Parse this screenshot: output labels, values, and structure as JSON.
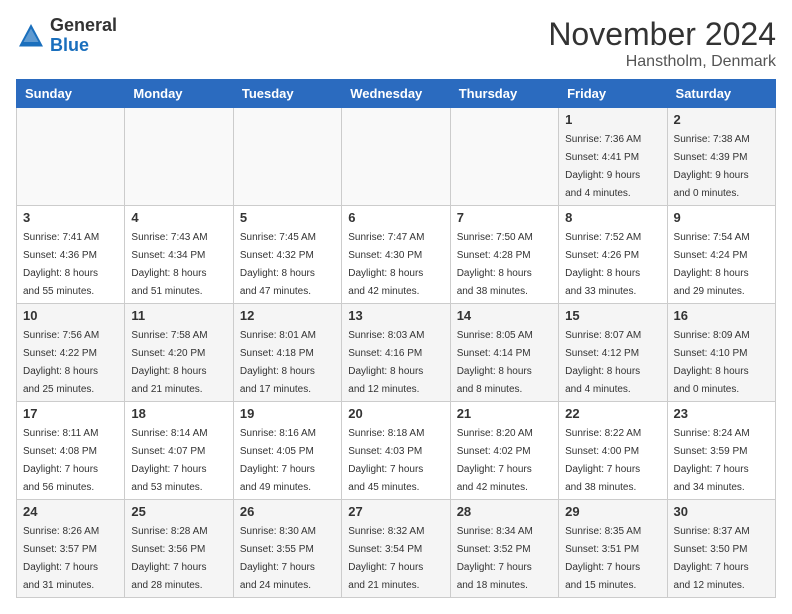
{
  "logo": {
    "general": "General",
    "blue": "Blue"
  },
  "title": "November 2024",
  "location": "Hanstholm, Denmark",
  "days_of_week": [
    "Sunday",
    "Monday",
    "Tuesday",
    "Wednesday",
    "Thursday",
    "Friday",
    "Saturday"
  ],
  "weeks": [
    [
      {
        "day": "",
        "info": ""
      },
      {
        "day": "",
        "info": ""
      },
      {
        "day": "",
        "info": ""
      },
      {
        "day": "",
        "info": ""
      },
      {
        "day": "",
        "info": ""
      },
      {
        "day": "1",
        "info": "Sunrise: 7:36 AM\nSunset: 4:41 PM\nDaylight: 9 hours\nand 4 minutes."
      },
      {
        "day": "2",
        "info": "Sunrise: 7:38 AM\nSunset: 4:39 PM\nDaylight: 9 hours\nand 0 minutes."
      }
    ],
    [
      {
        "day": "3",
        "info": "Sunrise: 7:41 AM\nSunset: 4:36 PM\nDaylight: 8 hours\nand 55 minutes."
      },
      {
        "day": "4",
        "info": "Sunrise: 7:43 AM\nSunset: 4:34 PM\nDaylight: 8 hours\nand 51 minutes."
      },
      {
        "day": "5",
        "info": "Sunrise: 7:45 AM\nSunset: 4:32 PM\nDaylight: 8 hours\nand 47 minutes."
      },
      {
        "day": "6",
        "info": "Sunrise: 7:47 AM\nSunset: 4:30 PM\nDaylight: 8 hours\nand 42 minutes."
      },
      {
        "day": "7",
        "info": "Sunrise: 7:50 AM\nSunset: 4:28 PM\nDaylight: 8 hours\nand 38 minutes."
      },
      {
        "day": "8",
        "info": "Sunrise: 7:52 AM\nSunset: 4:26 PM\nDaylight: 8 hours\nand 33 minutes."
      },
      {
        "day": "9",
        "info": "Sunrise: 7:54 AM\nSunset: 4:24 PM\nDaylight: 8 hours\nand 29 minutes."
      }
    ],
    [
      {
        "day": "10",
        "info": "Sunrise: 7:56 AM\nSunset: 4:22 PM\nDaylight: 8 hours\nand 25 minutes."
      },
      {
        "day": "11",
        "info": "Sunrise: 7:58 AM\nSunset: 4:20 PM\nDaylight: 8 hours\nand 21 minutes."
      },
      {
        "day": "12",
        "info": "Sunrise: 8:01 AM\nSunset: 4:18 PM\nDaylight: 8 hours\nand 17 minutes."
      },
      {
        "day": "13",
        "info": "Sunrise: 8:03 AM\nSunset: 4:16 PM\nDaylight: 8 hours\nand 12 minutes."
      },
      {
        "day": "14",
        "info": "Sunrise: 8:05 AM\nSunset: 4:14 PM\nDaylight: 8 hours\nand 8 minutes."
      },
      {
        "day": "15",
        "info": "Sunrise: 8:07 AM\nSunset: 4:12 PM\nDaylight: 8 hours\nand 4 minutes."
      },
      {
        "day": "16",
        "info": "Sunrise: 8:09 AM\nSunset: 4:10 PM\nDaylight: 8 hours\nand 0 minutes."
      }
    ],
    [
      {
        "day": "17",
        "info": "Sunrise: 8:11 AM\nSunset: 4:08 PM\nDaylight: 7 hours\nand 56 minutes."
      },
      {
        "day": "18",
        "info": "Sunrise: 8:14 AM\nSunset: 4:07 PM\nDaylight: 7 hours\nand 53 minutes."
      },
      {
        "day": "19",
        "info": "Sunrise: 8:16 AM\nSunset: 4:05 PM\nDaylight: 7 hours\nand 49 minutes."
      },
      {
        "day": "20",
        "info": "Sunrise: 8:18 AM\nSunset: 4:03 PM\nDaylight: 7 hours\nand 45 minutes."
      },
      {
        "day": "21",
        "info": "Sunrise: 8:20 AM\nSunset: 4:02 PM\nDaylight: 7 hours\nand 42 minutes."
      },
      {
        "day": "22",
        "info": "Sunrise: 8:22 AM\nSunset: 4:00 PM\nDaylight: 7 hours\nand 38 minutes."
      },
      {
        "day": "23",
        "info": "Sunrise: 8:24 AM\nSunset: 3:59 PM\nDaylight: 7 hours\nand 34 minutes."
      }
    ],
    [
      {
        "day": "24",
        "info": "Sunrise: 8:26 AM\nSunset: 3:57 PM\nDaylight: 7 hours\nand 31 minutes."
      },
      {
        "day": "25",
        "info": "Sunrise: 8:28 AM\nSunset: 3:56 PM\nDaylight: 7 hours\nand 28 minutes."
      },
      {
        "day": "26",
        "info": "Sunrise: 8:30 AM\nSunset: 3:55 PM\nDaylight: 7 hours\nand 24 minutes."
      },
      {
        "day": "27",
        "info": "Sunrise: 8:32 AM\nSunset: 3:54 PM\nDaylight: 7 hours\nand 21 minutes."
      },
      {
        "day": "28",
        "info": "Sunrise: 8:34 AM\nSunset: 3:52 PM\nDaylight: 7 hours\nand 18 minutes."
      },
      {
        "day": "29",
        "info": "Sunrise: 8:35 AM\nSunset: 3:51 PM\nDaylight: 7 hours\nand 15 minutes."
      },
      {
        "day": "30",
        "info": "Sunrise: 8:37 AM\nSunset: 3:50 PM\nDaylight: 7 hours\nand 12 minutes."
      }
    ]
  ]
}
